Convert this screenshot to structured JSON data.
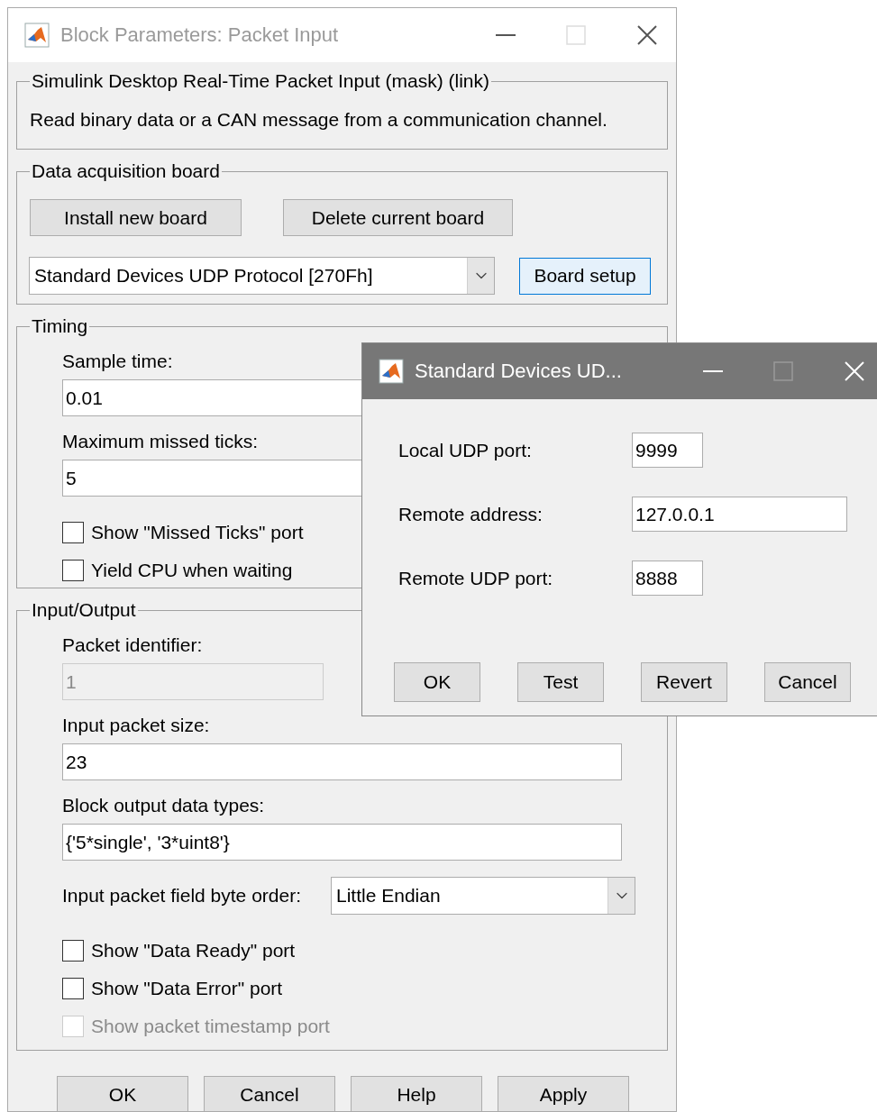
{
  "main_window": {
    "title": "Block Parameters: Packet Input",
    "active": false,
    "groups": [
      {
        "title": "Simulink Desktop Real-Time Packet Input (mask) (link)",
        "items": [
          {
            "kind": "text",
            "text": "Read binary data or a CAN message from a communication channel."
          }
        ]
      },
      {
        "title": "Data acquisition board",
        "items": [
          {
            "kind": "buttons",
            "buttons": [
              {
                "label": "Install new board",
                "focused": false
              },
              {
                "label": "Delete current board",
                "focused": false
              }
            ]
          },
          {
            "kind": "select",
            "value": "Standard Devices UDP Protocol [270Fh]",
            "button": {
              "label": "Board setup",
              "focused": true
            }
          }
        ]
      },
      {
        "title": "Timing",
        "items": [
          {
            "kind": "field",
            "label": "Sample time:",
            "value": "0.01",
            "disabled": false
          },
          {
            "kind": "field",
            "label": "Maximum missed ticks:",
            "value": "5",
            "disabled": false
          },
          {
            "kind": "checkbox",
            "label": "Show \"Missed Ticks\" port",
            "checked": false,
            "disabled": false
          },
          {
            "kind": "checkbox",
            "label": "Yield CPU when waiting",
            "checked": false,
            "disabled": false
          }
        ]
      },
      {
        "title": "Input/Output",
        "items": [
          {
            "kind": "short_field",
            "label": "Packet identifier:",
            "value": "1",
            "disabled": true
          },
          {
            "kind": "field",
            "label": "Input packet size:",
            "value": "23",
            "disabled": false
          },
          {
            "kind": "field",
            "label": "Block output data types:",
            "value": "{'5*single', '3*uint8'}",
            "disabled": false
          },
          {
            "kind": "labeled_select",
            "label": "Input packet field byte order:",
            "value": "Little Endian"
          },
          {
            "kind": "checkbox",
            "label": "Show \"Data Ready\" port",
            "checked": false,
            "disabled": false
          },
          {
            "kind": "checkbox",
            "label": "Show \"Data Error\" port",
            "checked": false,
            "disabled": false
          },
          {
            "kind": "checkbox",
            "label": "Show packet timestamp port",
            "checked": false,
            "disabled": true
          }
        ]
      }
    ],
    "buttons": [
      {
        "label": "OK",
        "focused": false
      },
      {
        "label": "Cancel",
        "focused": false
      },
      {
        "label": "Help",
        "focused": false
      },
      {
        "label": "Apply",
        "focused": false
      }
    ]
  },
  "dialog": {
    "title": "Standard Devices UD...",
    "active": true,
    "fields": [
      {
        "kind": "port",
        "label": "Local UDP port:",
        "value": "9999"
      },
      {
        "kind": "address",
        "label": "Remote address:",
        "value": "127.0.0.1"
      },
      {
        "kind": "port",
        "label": "Remote UDP port:",
        "value": "8888"
      }
    ],
    "buttons": [
      {
        "label": "OK",
        "focused": false
      },
      {
        "label": "Test",
        "focused": false
      },
      {
        "label": "Revert",
        "focused": false
      },
      {
        "label": "Cancel",
        "focused": false
      }
    ]
  }
}
